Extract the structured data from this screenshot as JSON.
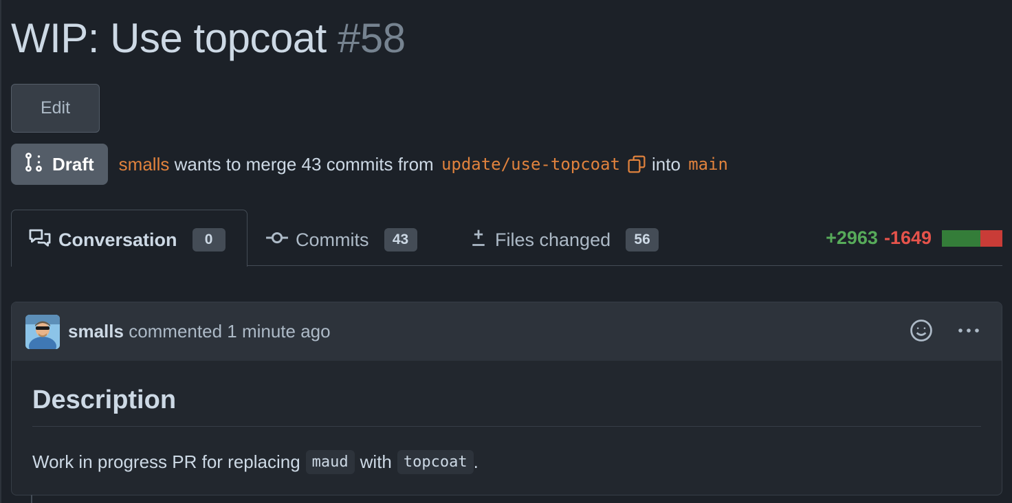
{
  "pr": {
    "title": "WIP: Use topcoat",
    "number": "#58",
    "edit_label": "Edit",
    "state_label": "Draft",
    "author": "smalls",
    "merge_text": "wants to merge 43 commits from",
    "head_branch": "update/use-topcoat",
    "into_text": "into",
    "base_branch": "main"
  },
  "tabs": [
    {
      "label": "Conversation",
      "count": "0",
      "icon": "comment-discussion-icon"
    },
    {
      "label": "Commits",
      "count": "43",
      "icon": "git-commit-icon"
    },
    {
      "label": "Files changed",
      "count": "56",
      "icon": "file-diff-icon"
    }
  ],
  "diffstat": {
    "additions": "+2963",
    "deletions": "-1649",
    "added_fraction": 0.64,
    "add_color": "#347d39",
    "del_color": "#c93c37"
  },
  "comment": {
    "author": "smalls",
    "action": "commented",
    "time": "1 minute ago",
    "heading": "Description",
    "body_prefix": "Work in progress PR for replacing",
    "code_1": "maud",
    "body_mid": "with",
    "code_2": "topcoat",
    "body_suffix": "."
  },
  "colors": {
    "background": "#1c2128",
    "accent_orange": "#e0823d",
    "green": "#57ab5a",
    "red": "#e5534b"
  }
}
